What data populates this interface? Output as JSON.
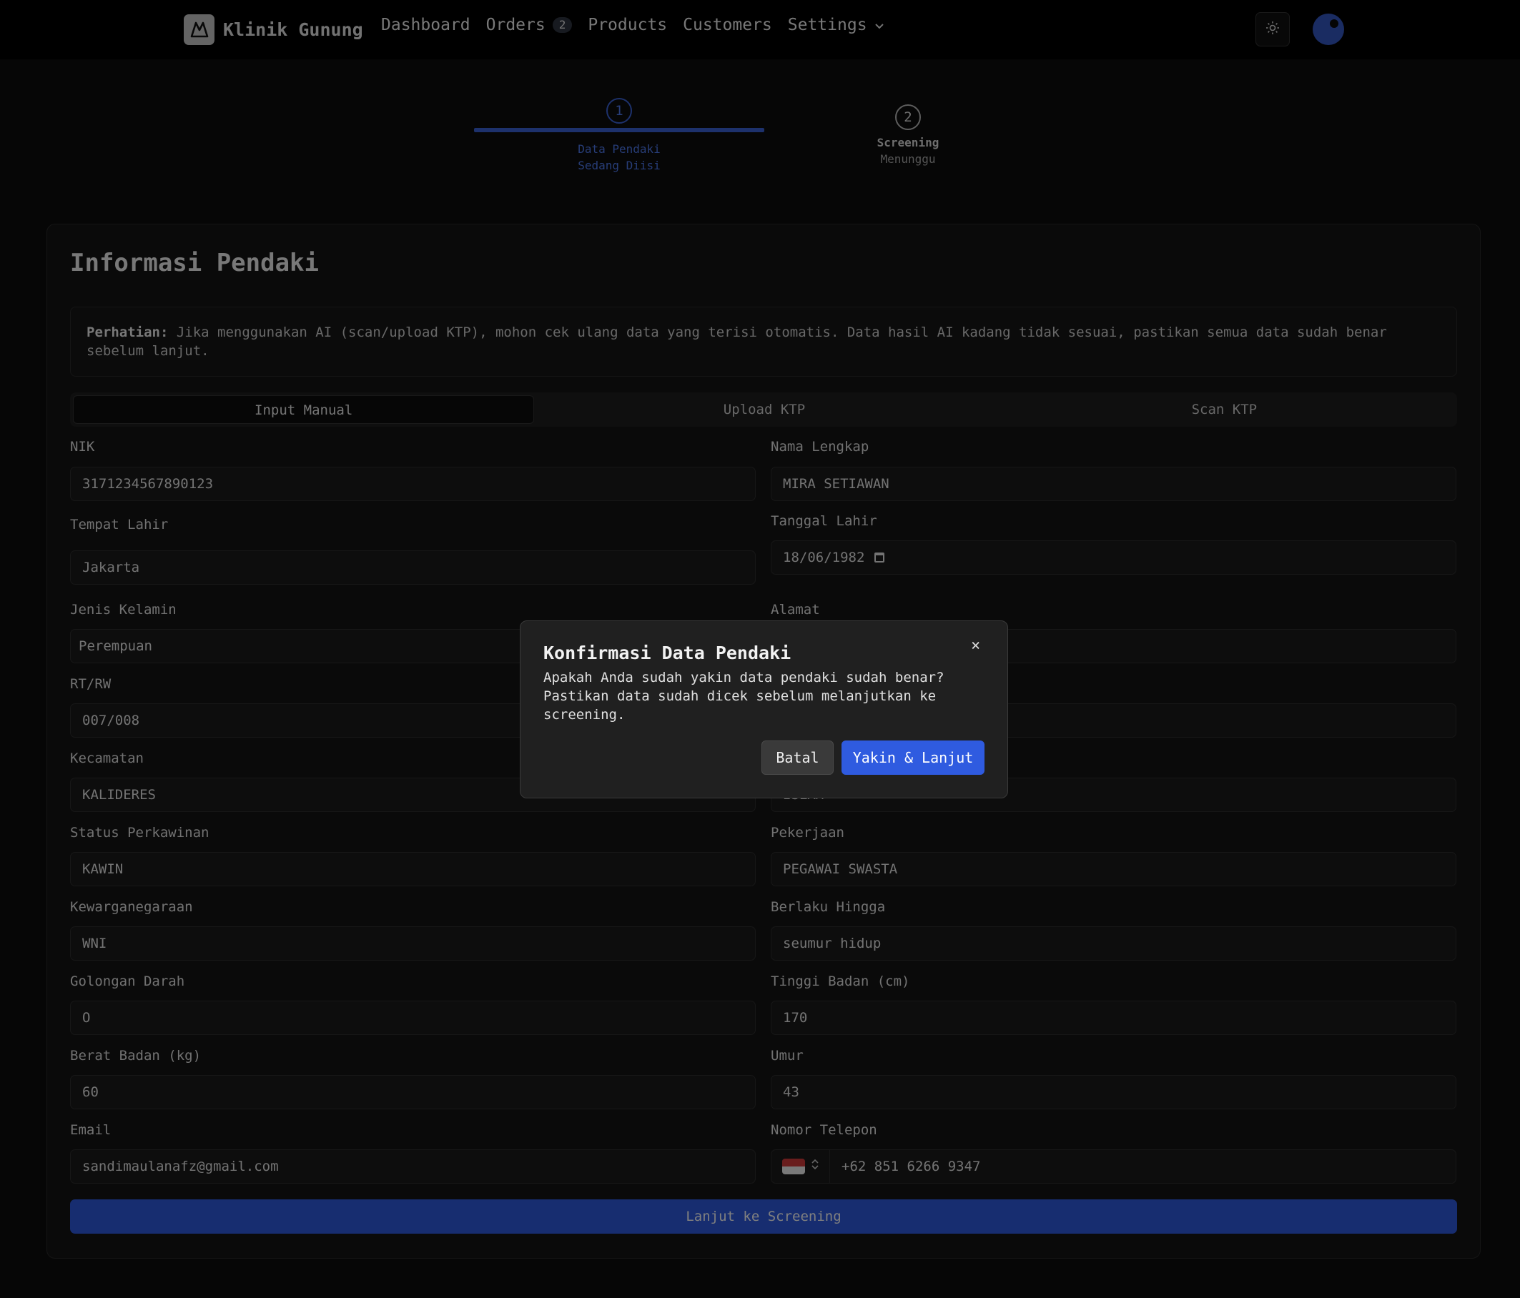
{
  "nav": {
    "brand": "Klinik Gunung",
    "links": [
      {
        "label": "Dashboard"
      },
      {
        "label": "Orders",
        "badge": "2"
      },
      {
        "label": "Products"
      },
      {
        "label": "Customers"
      },
      {
        "label": "Settings"
      }
    ]
  },
  "stepper": {
    "steps": [
      {
        "number": "1",
        "title": "Data Pendaki",
        "status": "Sedang Diisi"
      },
      {
        "number": "2",
        "title": "Screening",
        "status": "Menunggu"
      }
    ]
  },
  "form": {
    "title": "Informasi Pendaki",
    "notice_label": "Perhatian:",
    "notice_text": " Jika menggunakan AI (scan/upload KTP), mohon cek ulang data yang terisi otomatis. Data hasil AI kadang tidak sesuai, pastikan semua data sudah benar sebelum lanjut.",
    "tabs": [
      "Input Manual",
      "Upload KTP",
      "Scan KTP"
    ],
    "active_tab": "Input Manual",
    "fields": {
      "nik": {
        "label": "NIK",
        "value": "3171234567890123"
      },
      "nama": {
        "label": "Nama Lengkap",
        "value": "MIRA SETIAWAN"
      },
      "tempat_lahir": {
        "label": "Tempat Lahir",
        "value": "Jakarta"
      },
      "tanggal_lahir": {
        "label": "Tanggal Lahir",
        "value": "18/06/1982"
      },
      "jenis_kelamin": {
        "label": "Jenis Kelamin",
        "value": "Perempuan"
      },
      "alamat": {
        "label": "Alamat",
        "value": ""
      },
      "rt_rw": {
        "label": "RT/RW",
        "value": "007/008"
      },
      "kecamatan": {
        "label": "Kecamatan",
        "value": "KALIDERES"
      },
      "agama": {
        "value": "ISLAM"
      },
      "status": {
        "label": "Status Perkawinan",
        "value": "KAWIN"
      },
      "pekerjaan": {
        "label": "Pekerjaan",
        "value": "PEGAWAI SWASTA"
      },
      "kewarganegaraan": {
        "label": "Kewarganegaraan",
        "value": "WNI"
      },
      "berlaku": {
        "label": "Berlaku Hingga",
        "value": "seumur hidup"
      },
      "golongan_darah": {
        "label": "Golongan Darah",
        "value": "O"
      },
      "tinggi": {
        "label": "Tinggi Badan (cm)",
        "value": "170"
      },
      "berat": {
        "label": "Berat Badan (kg)",
        "value": "60"
      },
      "umur": {
        "label": "Umur",
        "value": "43"
      },
      "email": {
        "label": "Email",
        "value": "sandimaulanafz@gmail.com"
      },
      "telepon": {
        "label": "Nomor Telepon",
        "value": "+62 851 6266 9347"
      }
    },
    "submit_label": "Lanjut ke Screening"
  },
  "modal": {
    "title": "Konfirmasi Data Pendaki",
    "body": "Apakah Anda sudah yakin data pendaki sudah benar? Pastikan data sudah dicek sebelum melanjutkan ke screening.",
    "close": "×",
    "cancel_label": "Batal",
    "confirm_label": "Yakin & Lanjut"
  },
  "colors": {
    "accent": "#2f5be0",
    "background": "#0c0c0c",
    "navbar": "#000000"
  },
  "icons": [
    "mountain-icon",
    "chevron-down-icon",
    "sun-icon",
    "calendar-icon",
    "flag-id-icon",
    "chevron-updown-icon",
    "close-icon"
  ]
}
